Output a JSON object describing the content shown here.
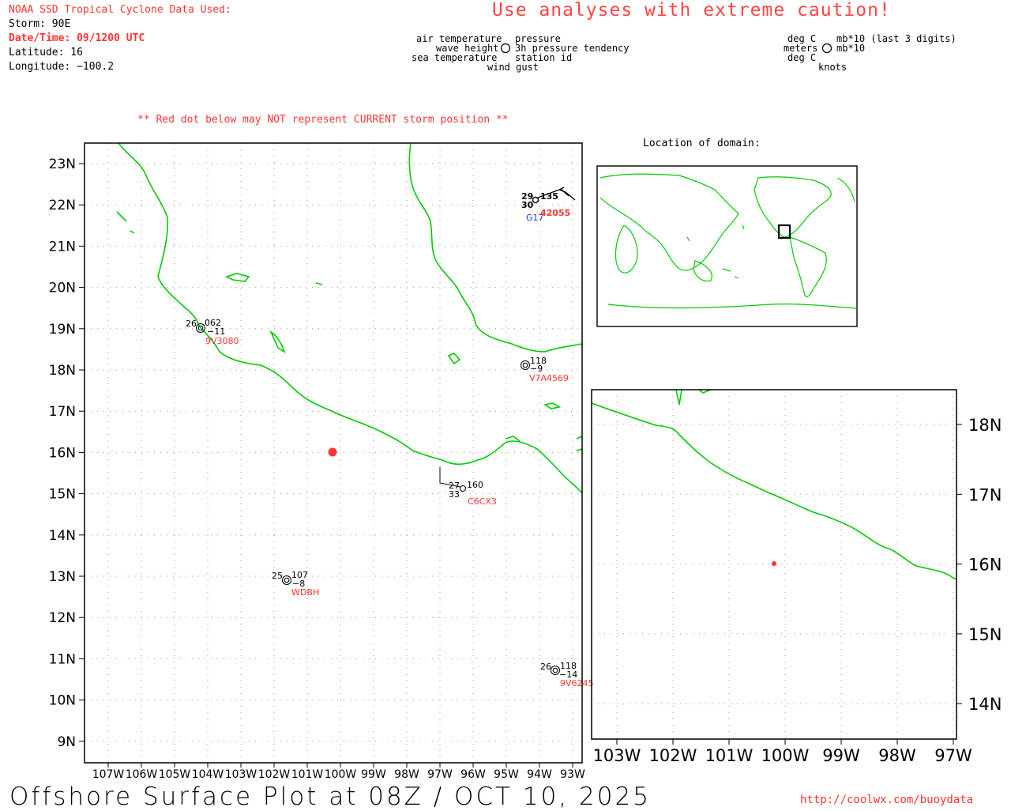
{
  "header": {
    "source": "NOAA SSD Tropical Cyclone Data Used:",
    "storm": "Storm: 90E",
    "datetime": "Date/Time: 09/1200 UTC",
    "latitude": "Latitude: 16",
    "longitude": "Longitude: −100.2"
  },
  "warning": "Use analyses with extreme caution!",
  "legend_left": {
    "air_temperature": "air temperature",
    "wave_height": "wave height",
    "sea_temperature": "sea temperature",
    "pressure": "pressure",
    "pressure_tendency": "3h pressure tendency",
    "station_id": "station id",
    "wind_gust": "wind gust"
  },
  "legend_right": {
    "deg_c_1": "deg C",
    "meters": "meters",
    "deg_c_2": "deg C",
    "mb_last3": "mb*10 (last 3 digits)",
    "mb": "mb*10",
    "knots": "knots"
  },
  "note": "** Red dot below may NOT represent CURRENT storm position **",
  "inset_title": "Location of domain:",
  "storm_position": {
    "lat": 16.0,
    "lon": -100.2,
    "color": "#ff3333"
  },
  "main_map": {
    "lat_ticks": [
      "23N",
      "22N",
      "21N",
      "20N",
      "19N",
      "18N",
      "17N",
      "16N",
      "15N",
      "14N",
      "13N",
      "12N",
      "11N",
      "10N",
      "9N"
    ],
    "lon_ticks": [
      "107W",
      "106W",
      "105W",
      "104W",
      "103W",
      "102W",
      "101W",
      "100W",
      "99W",
      "98W",
      "97W",
      "96W",
      "95W",
      "94W",
      "93W"
    ],
    "coast_color": "#00cc00",
    "stations": [
      {
        "id": "9V3080",
        "air": "26",
        "pressure": "062",
        "tendency": "−11",
        "lat": 19.0,
        "lon": -104.2
      },
      {
        "id": "V7A4569",
        "air": "",
        "pressure": "118",
        "tendency": "−9",
        "lat": 18.1,
        "lon": -94.4
      },
      {
        "id": "C6CX3",
        "air": "27",
        "sea": "33",
        "pressure": "160",
        "tendency": "",
        "lat": 15.1,
        "lon": -96.3
      },
      {
        "id": "WDBH",
        "air": "25",
        "pressure": "107",
        "tendency": "−8",
        "lat": 12.9,
        "lon": -101.6
      },
      {
        "id": "9V6245",
        "air": "26",
        "pressure": "118",
        "tendency": "−14",
        "lat": 10.7,
        "lon": -93.6
      },
      {
        "id": "42055",
        "air": "29",
        "sea": "30",
        "pressure": "135",
        "gust": "G17",
        "lat": 22.1,
        "lon": -94.0
      }
    ]
  },
  "zoom_map": {
    "lat_ticks": [
      "18N",
      "17N",
      "16N",
      "15N",
      "14N"
    ],
    "lon_ticks": [
      "103W",
      "102W",
      "101W",
      "100W",
      "99W",
      "98W",
      "97W"
    ]
  },
  "footer": {
    "title": "Offshore Surface Plot at 08Z / OCT 10, 2025",
    "url": "http://coolwx.com/buoydata"
  }
}
